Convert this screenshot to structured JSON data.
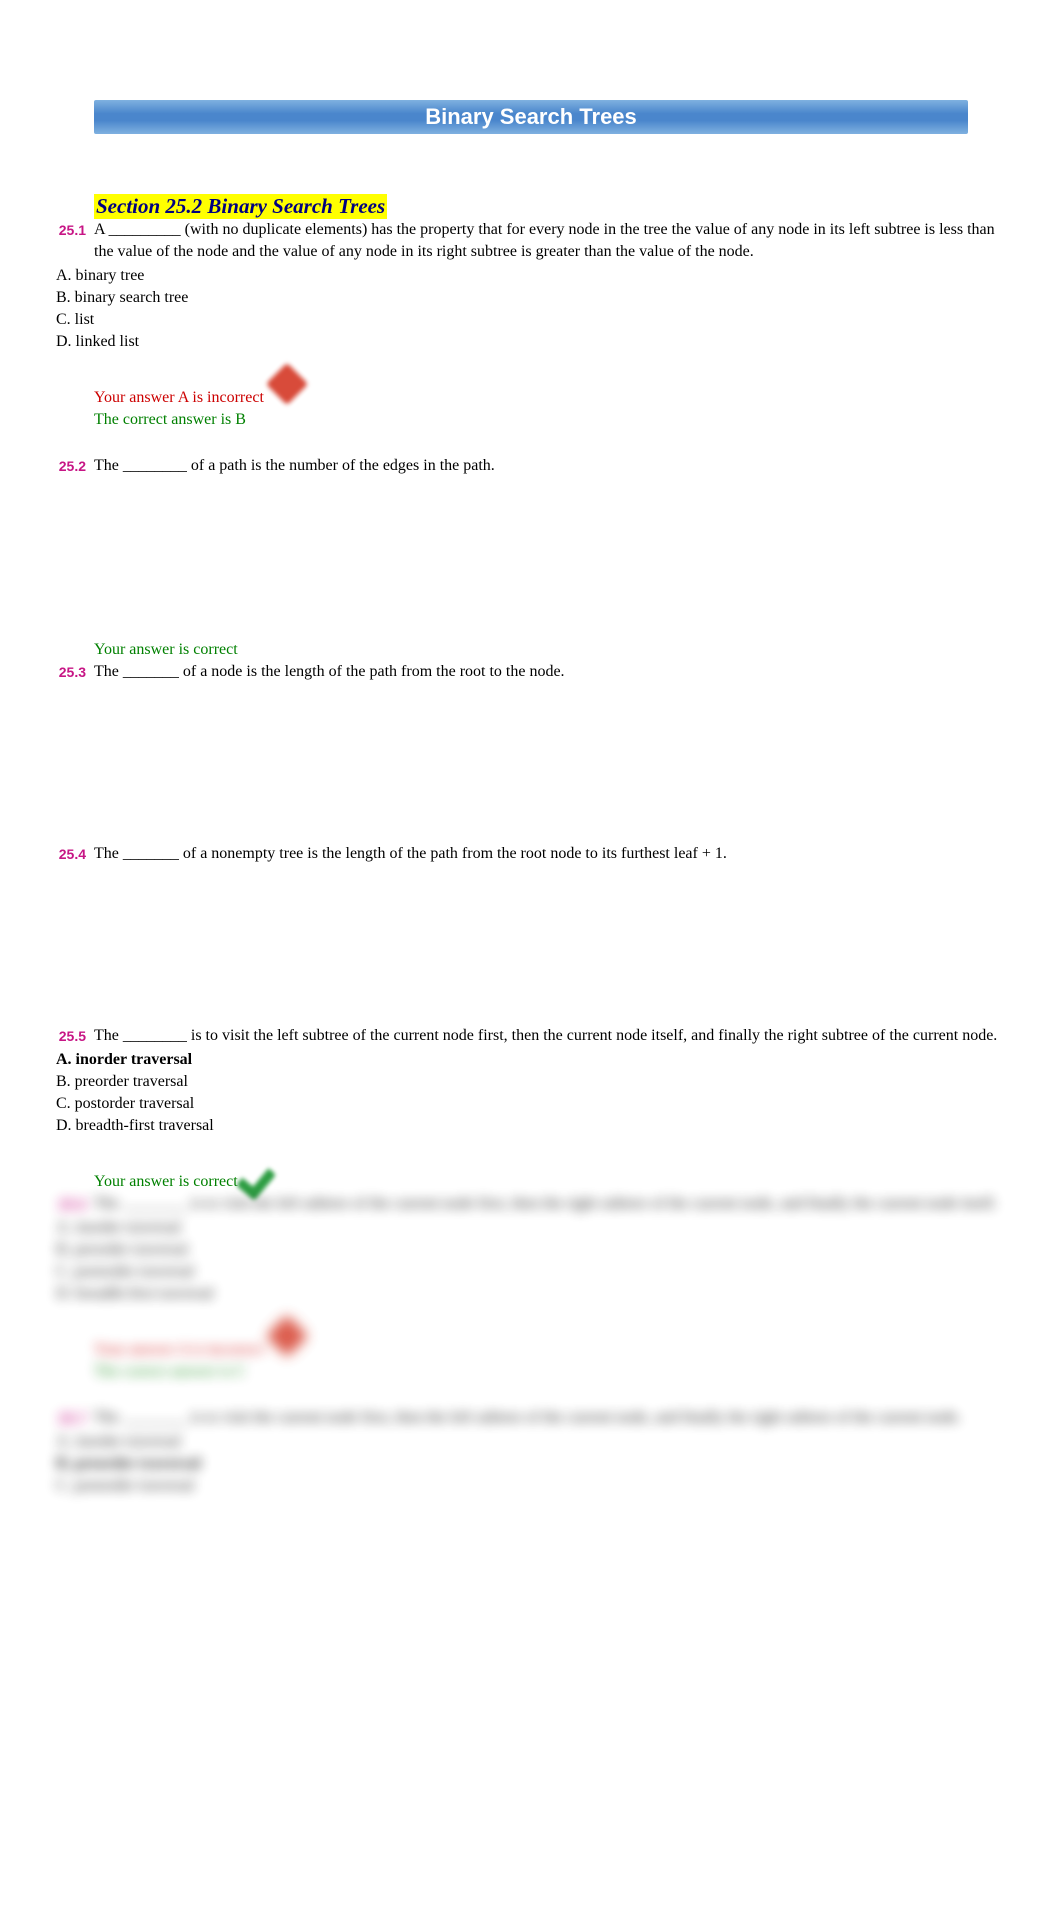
{
  "title": "Binary Search Trees",
  "section_heading": "Section 25.2 Binary Search Trees",
  "q1": {
    "num": "25.1",
    "text": "A _________ (with no duplicate elements) has the property that for every node in the tree the value of any node in its left subtree is less than the value of the node and the value of any node in its right subtree is greater than the value of the node.",
    "opts": {
      "A": "A. binary tree",
      "B": "B. binary search tree",
      "C": "C. list",
      "D": "D. linked list"
    },
    "feedback_wrong": "Your answer A is incorrect",
    "feedback_correct": "The correct answer is B"
  },
  "q2": {
    "num": "25.2",
    "text": "The ________ of a path is the number of the edges in the path.",
    "feedback_correct": "Your answer is correct"
  },
  "q3": {
    "num": "25.3",
    "text": "The _______ of a node is the length of the path from the root to the node."
  },
  "q4": {
    "num": "25.4",
    "text": "The _______ of a nonempty tree is the length of the path from the root node to its furthest leaf + 1."
  },
  "q5": {
    "num": "25.5",
    "text": "The ________ is to visit the left subtree of the current node first, then the current node itself, and finally the right subtree of the current node.",
    "opts": {
      "A": "A. inorder traversal",
      "B": "B. preorder traversal",
      "C": "C. postorder traversal",
      "D": "D. breadth-first traversal"
    },
    "feedback_correct": "Your answer is correct"
  },
  "q6": {
    "num": "25.6",
    "text": "The ________ is to visit the left subtree of the current node first, then the right subtree of the current node, and finally the current node itself.",
    "opts": {
      "A": "A. inorder traversal",
      "B": "B. preorder traversal",
      "C": "C. postorder traversal",
      "D": "D. breadth-first traversal"
    },
    "feedback_wrong": "Your answer A is incorrect",
    "feedback_correct": "The correct answer is C"
  },
  "q7": {
    "num": "25.7",
    "text": "The ________ is to visit the current node first, then the left subtree of the current node, and finally the right subtree of the current node.",
    "opts": {
      "A": "A. inorder traversal",
      "B": "B. preorder traversal",
      "C": "C. postorder traversal"
    }
  }
}
